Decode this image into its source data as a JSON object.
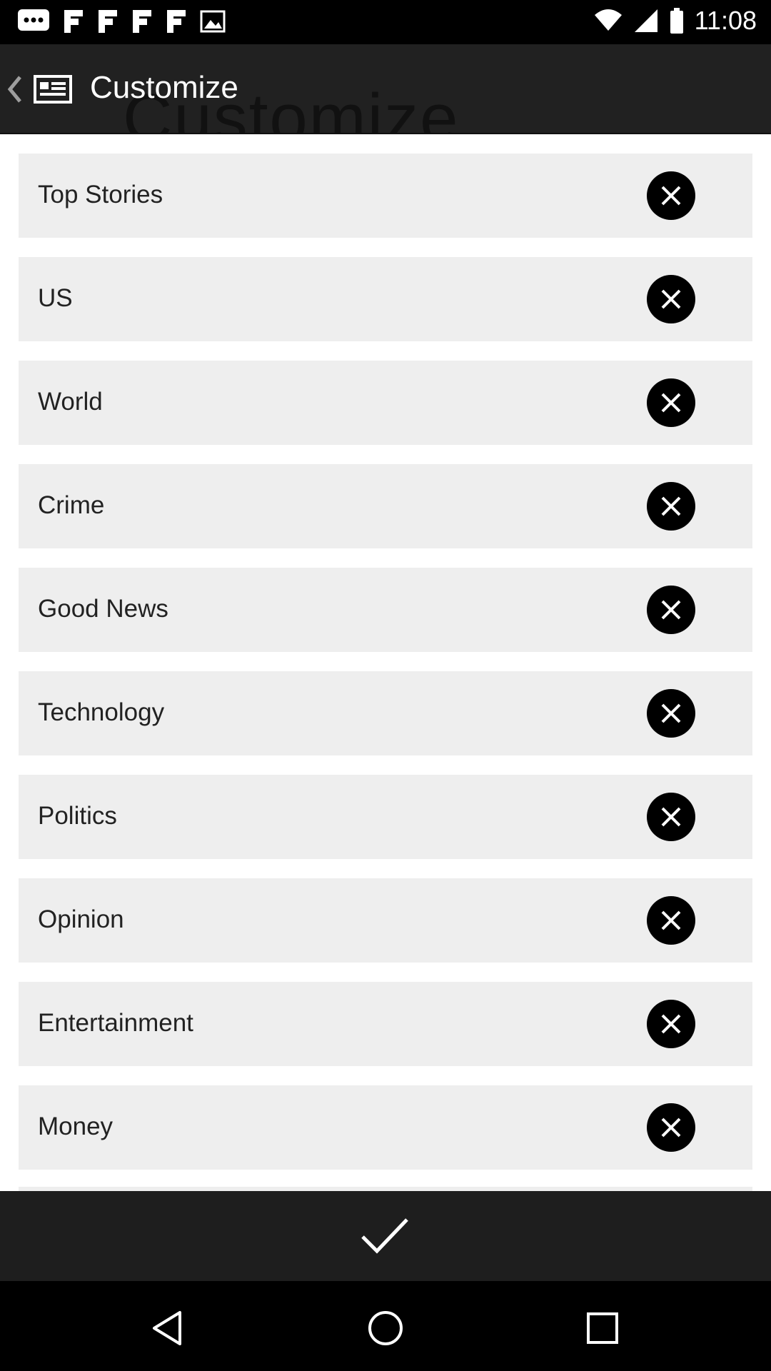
{
  "status_bar": {
    "time": "11:08",
    "icons": [
      "chat-icon",
      "flipboard-icon",
      "flipboard-icon",
      "flipboard-icon",
      "flipboard-icon",
      "photo-icon",
      "wifi-icon",
      "signal-icon",
      "battery-icon"
    ]
  },
  "app_bar": {
    "title": "Customize",
    "title_ghost": "Customize"
  },
  "categories": [
    {
      "label": "Top Stories"
    },
    {
      "label": "US"
    },
    {
      "label": "World"
    },
    {
      "label": "Crime"
    },
    {
      "label": "Good News"
    },
    {
      "label": "Technology"
    },
    {
      "label": "Politics"
    },
    {
      "label": "Opinion"
    },
    {
      "label": "Entertainment"
    },
    {
      "label": "Money"
    }
  ],
  "colors": {
    "app_bar": "#212121",
    "item_background": "#eeeeee",
    "remove_button": "#000000",
    "confirm_bar": "#1e1e1e"
  }
}
